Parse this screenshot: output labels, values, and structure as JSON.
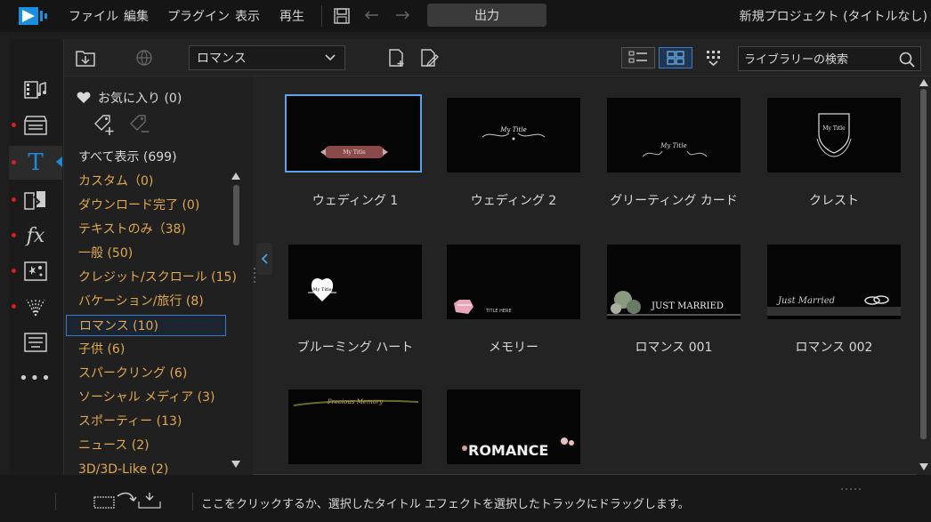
{
  "menubar": {
    "items": [
      "ファイル",
      "編集",
      "プラグイン",
      "表示",
      "再生"
    ],
    "output_label": "出力",
    "project_title": "新規プロジェクト (タイトルなし)"
  },
  "left_tools": [
    {
      "icon": "media-room-icon",
      "marked": false
    },
    {
      "icon": "fx-clapper-icon",
      "marked": true
    },
    {
      "icon": "title-T-icon",
      "marked": true,
      "active": true
    },
    {
      "icon": "transition-icon",
      "marked": true
    },
    {
      "icon": "fx-icon",
      "marked": true
    },
    {
      "icon": "particle-icon",
      "marked": true
    },
    {
      "icon": "firework-icon",
      "marked": true
    },
    {
      "icon": "subtitle-icon",
      "marked": false
    },
    {
      "icon": "more-icon",
      "marked": false
    }
  ],
  "library_toolbar": {
    "category_selected": "ロマンス",
    "search_placeholder": "ライブラリーの検索"
  },
  "categories": {
    "favorites": "お気に入り (0)",
    "items": [
      "すべて表示 (699)",
      "カスタム（0)",
      "ダウンロード完了 (0)",
      "テキストのみ（38)",
      "一般 (50)",
      "クレジット/スクロール (15)",
      "バケーション/旅行 (8)",
      "ロマンス (10)",
      "子供 (6)",
      "スパークリング (6)",
      "ソーシャル メディア (3)",
      "スポーティー (13)",
      "ニュース (2)",
      "3D/3D-Like (2)"
    ],
    "selected_index": 7
  },
  "tiles": [
    {
      "label": "ウェディング 1",
      "art": "My Title",
      "selected": true
    },
    {
      "label": "ウェディング 2",
      "art": "My Title"
    },
    {
      "label": "グリーティング カード",
      "art": "My Title"
    },
    {
      "label": "クレスト",
      "art": "My Title"
    },
    {
      "label": "ブルーミング ハート",
      "art": "My Title"
    },
    {
      "label": "メモリー",
      "art": "TITLE HERE"
    },
    {
      "label": "ロマンス 001",
      "art": "JUST MARRIED"
    },
    {
      "label": "ロマンス 002",
      "art": "Just Married"
    },
    {
      "label": "",
      "art": "Precious Memory"
    },
    {
      "label": "",
      "art": "ROMANCE"
    }
  ],
  "status": {
    "text": "ここをクリックするか、選択したタイトル エフェクトを選択したトラックにドラッグします。"
  },
  "colors": {
    "accent": "#1e8ad6",
    "category_text": "#e0a850",
    "marker_red": "#d42020"
  }
}
